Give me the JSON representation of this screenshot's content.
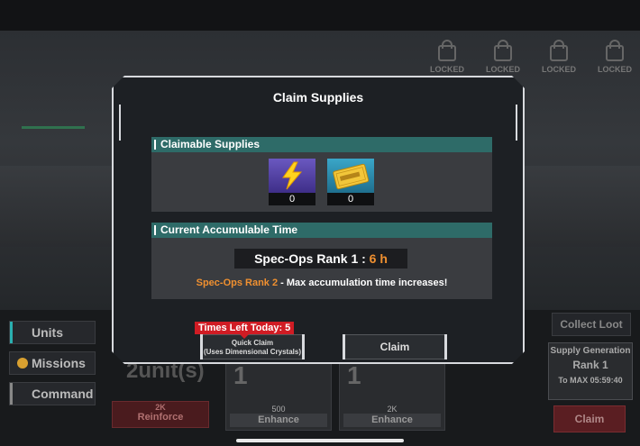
{
  "background": {
    "locked_label": "LOCKED",
    "locked_count": 4,
    "nav": [
      {
        "label": "Units"
      },
      {
        "label": "Missions"
      },
      {
        "label": "Command"
      }
    ],
    "unit_count": "2unit(s)",
    "reinforce": {
      "cost": "2K",
      "label": "Reinforce"
    },
    "cards": [
      {
        "num": "1",
        "cost": "500",
        "label": "Enhance"
      },
      {
        "num": "1",
        "cost": "2K",
        "label": "Enhance"
      }
    ],
    "collect_loot": "Collect Loot",
    "supply_generation": {
      "title": "Supply Generation",
      "rank": "Rank 1",
      "to_max": "To MAX 05:59:40"
    },
    "claim_right": "Claim"
  },
  "modal": {
    "title": "Claim Supplies",
    "claimable_header": "Claimable Supplies",
    "items": [
      {
        "icon": "lightning-bolt-icon",
        "qty": "0",
        "bg": "#5a46a8"
      },
      {
        "icon": "credit-ticket-icon",
        "qty": "0",
        "bg": "#2e8fb0"
      }
    ],
    "time_header": "Current Accumulable Time",
    "rank_label": "Spec-Ops Rank 1 :",
    "rank_hours": "6 h",
    "next_rank": "Spec-Ops Rank 2",
    "next_rank_note": " - Max accumulation time increases!",
    "times_left_label": "Times Left Today:",
    "times_left_value": "5",
    "quick_claim_line1": "Quick Claim",
    "quick_claim_line2": "(Uses Dimensional Crystals)",
    "claim_label": "Claim"
  },
  "colors": {
    "accent_teal": "#2e6b68",
    "highlight_orange": "#f09030",
    "alert_red": "#d01c24"
  }
}
